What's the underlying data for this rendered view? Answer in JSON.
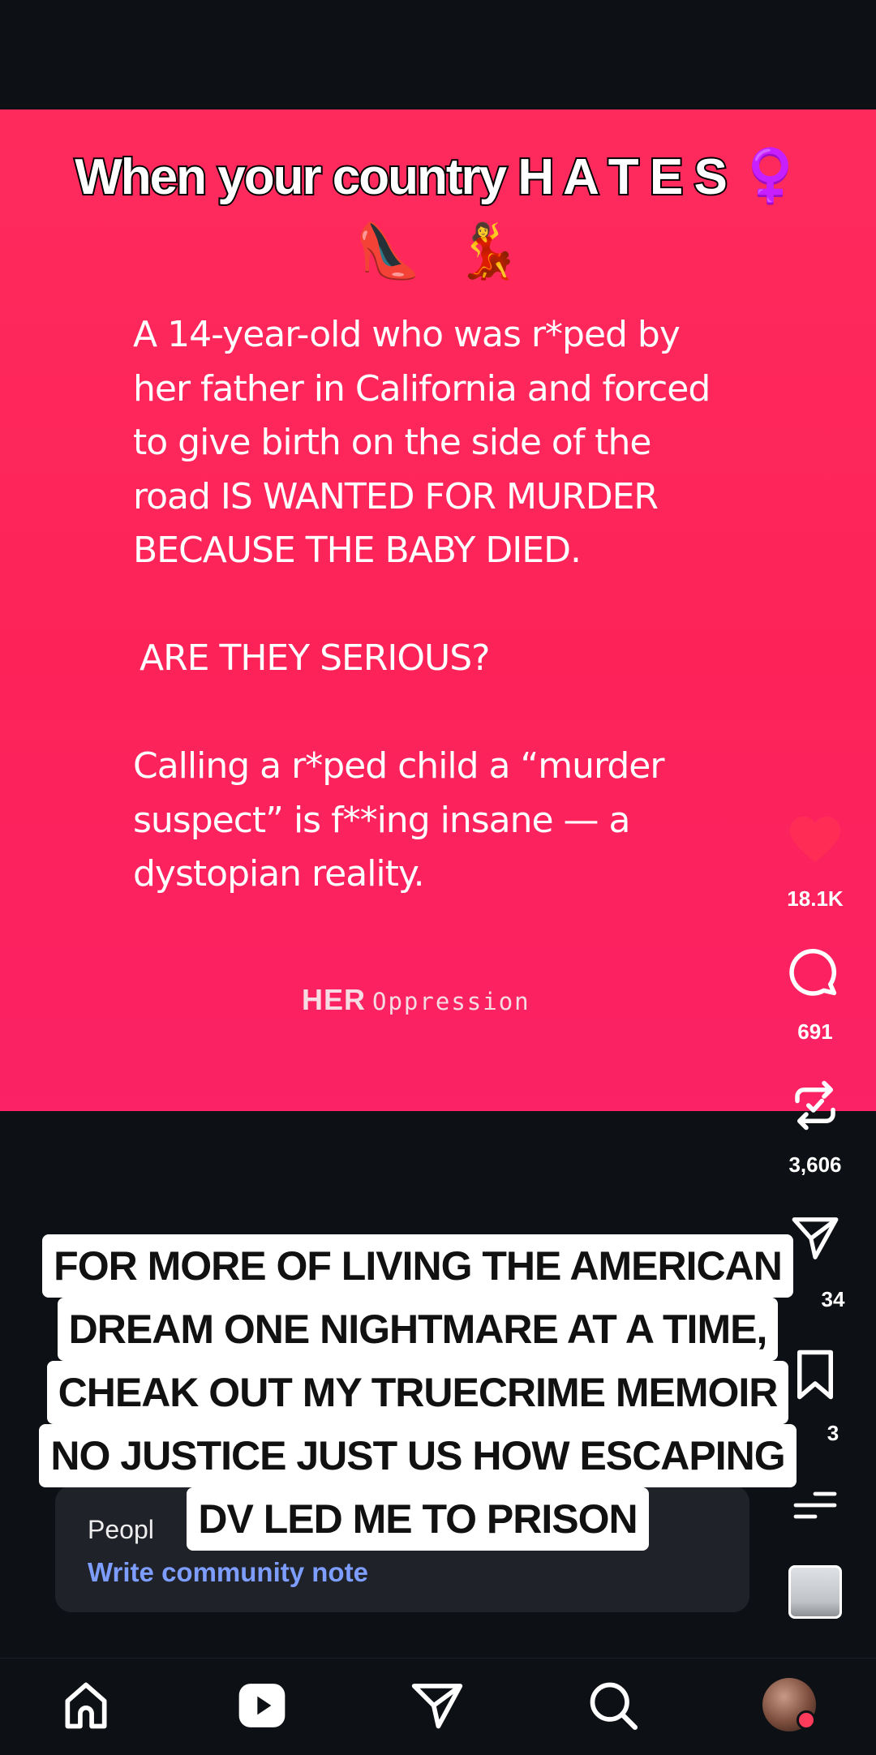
{
  "post": {
    "title": "When your country H A T E S",
    "title_emoji": "♀️",
    "emoji_row": [
      "👠",
      "💃"
    ],
    "body": [
      "A 14-year-old  who was r*ped by",
      "her father in California and forced",
      "to give birth on the side of the",
      "road IS WANTED FOR MURDER",
      "BECAUSE THE BABY DIED.",
      "",
      " ARE THEY SERIOUS?",
      "",
      "Calling a r*ped child a “murder",
      "suspect” is f**ing insane — a",
      "dystopian reality."
    ],
    "brand_bold": "HER",
    "brand_rest": "Oppression"
  },
  "actions": {
    "likes": "18.1K",
    "comments": "691",
    "reposts": "3,606",
    "shares_partial": "34",
    "saves_partial": "3"
  },
  "community_note": {
    "label_partial": "Peopl",
    "link": "Write community note"
  },
  "caption_overlay": [
    "FOR MORE OF LIVING THE AMERICAN",
    "DREAM ONE NIGHTMARE AT A TIME,",
    "CHEAK OUT MY TRUECRIME MEMOIR",
    "NO JUSTICE JUST US HOW ESCAPING",
    "DV LED ME TO PRISON"
  ],
  "nav": [
    "home-icon",
    "reels-icon",
    "messages-icon",
    "search-icon",
    "profile-avatar"
  ],
  "colors": {
    "card": "#fd2359",
    "like": "#ff2d55",
    "link": "#7d9dff",
    "background": "#0d1014"
  }
}
